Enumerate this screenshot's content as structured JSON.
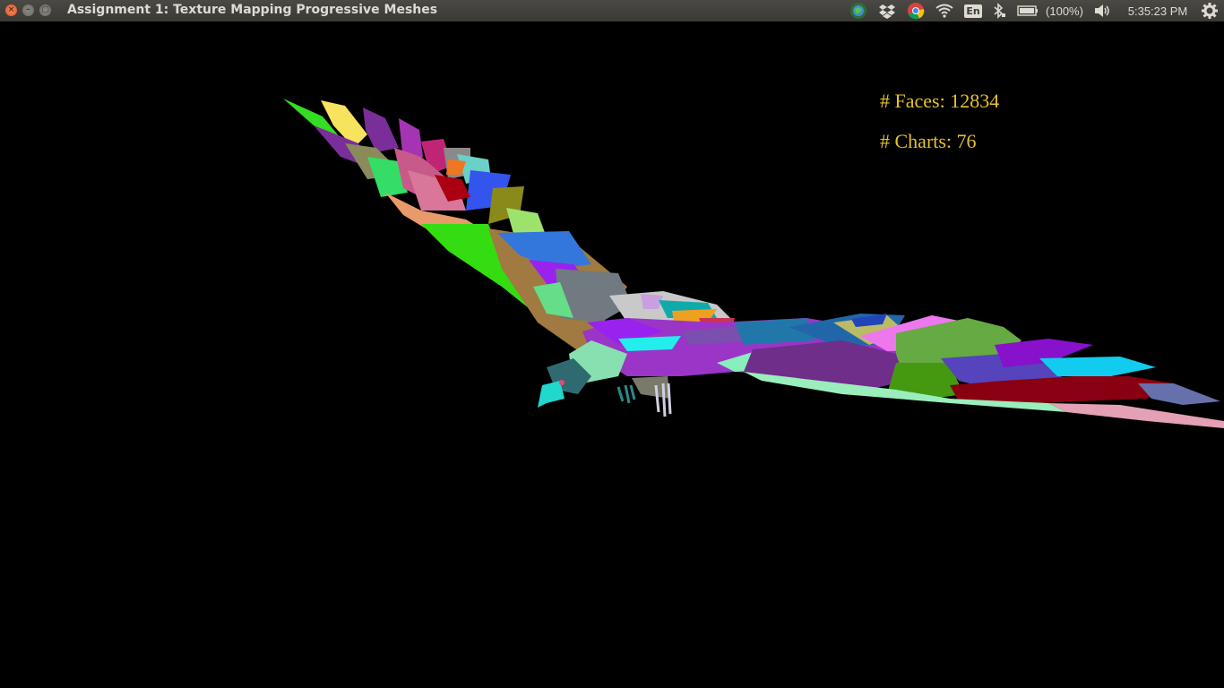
{
  "window": {
    "title": "Assignment 1: Texture Mapping Progressive Meshes",
    "close_glyph": "×",
    "minimize_glyph": "–",
    "maximize_glyph": "▢"
  },
  "tray": {
    "icons": [
      "globe-icon",
      "dropbox-icon",
      "chrome-icon",
      "wifi-icon",
      "keyboard-layout-icon",
      "bluetooth-icon",
      "battery-icon",
      "volume-icon",
      "gear-icon"
    ],
    "keyboard_layout": "En",
    "battery_text": "(100%)",
    "clock": "5:35:23 PM"
  },
  "viewport": {
    "background": "#000000",
    "stats": {
      "faces_label": "# Faces: 12834",
      "charts_label": "# Charts: 76"
    },
    "stats_color": "#e6c12d",
    "model": "eagle mesh colored by texture charts"
  }
}
